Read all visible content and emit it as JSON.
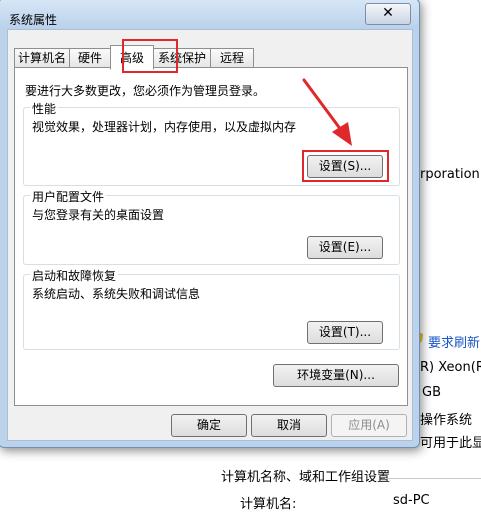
{
  "background_window": {
    "corporation_text": "rporation.",
    "link_text": "要求刷新",
    "processor_text": "R) Xeon(R",
    "memory_text": "GB",
    "os_text": "操作系统",
    "pen_text": "可用于此显示",
    "section_title": "计算机名称、域和工作组设置",
    "computer_name_label": "计算机名:",
    "computer_name_value": "sd-PC"
  },
  "dialog": {
    "title": "系统属性",
    "close_glyph": "✕",
    "tabs": [
      {
        "label": "计算机名"
      },
      {
        "label": "硬件"
      },
      {
        "label": "高级"
      },
      {
        "label": "系统保护"
      },
      {
        "label": "远程"
      }
    ],
    "active_tab": "高级",
    "admin_note": "要进行大多数更改，您必须作为管理员登录。",
    "groups": {
      "performance": {
        "label": "性能",
        "description": "视觉效果，处理器计划，内存使用，以及虚拟内存",
        "button": "设置(S)..."
      },
      "user_profiles": {
        "label": "用户配置文件",
        "description": "与您登录有关的桌面设置",
        "button": "设置(E)..."
      },
      "startup_recovery": {
        "label": "启动和故障恢复",
        "description": "系统启动、系统失败和调试信息",
        "button": "设置(T)..."
      }
    },
    "env_button": "环境变量(N)...",
    "ok_button": "确定",
    "cancel_button": "取消",
    "apply_button": "应用(A)"
  },
  "colors": {
    "highlight": "#e0272b",
    "link": "#1a56c7"
  }
}
